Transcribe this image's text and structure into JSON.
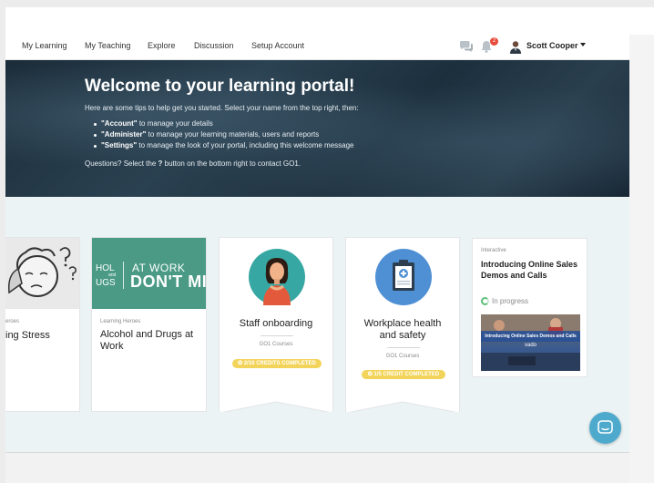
{
  "nav": {
    "items": [
      {
        "label": "My Learning"
      },
      {
        "label": "My Teaching"
      },
      {
        "label": "Explore"
      },
      {
        "label": "Discussion"
      },
      {
        "label": "Setup Account"
      }
    ],
    "notifications_count": "2",
    "user_name": "Scott Cooper"
  },
  "hero": {
    "title": "Welcome to your learning portal!",
    "intro": "Here are some tips to help get you started. Select your name from the top right, then:",
    "tips": [
      {
        "term": "\"Account\"",
        "text": " to manage your details"
      },
      {
        "term": "\"Administer\"",
        "text": " to manage your learning materials, users and reports"
      },
      {
        "term": "\"Settings\"",
        "text": " to manage the look of your portal, including this welcome message"
      }
    ],
    "question_pre": "Questions? Select the ",
    "question_mark": "?",
    "question_post": " button on the bottom right to contact GO1."
  },
  "cards": [
    {
      "provider": "eroes",
      "title": "ing Stress"
    },
    {
      "provider": "Learning Heroes",
      "title": "Alcohol and Drugs at Work",
      "image_text": {
        "left1": "HOL",
        "and": "and",
        "left2": "UGS",
        "top": "AT WORK",
        "big": "DON'T MI"
      }
    },
    {
      "title": "Staff onboarding",
      "provider": "GO1 Courses",
      "badge": "2/10 CREDITS COMPLETED"
    },
    {
      "title": "Workplace health and safety",
      "provider": "GO1 Courses",
      "badge": "1/5 CREDIT COMPLETED"
    },
    {
      "type": "Interactive",
      "title": "Introducing Online Sales Demos and Calls",
      "status": "In progress",
      "image_band": "Introducing Online Sales Demos and Calls",
      "image_logo": "vado"
    }
  ],
  "colors": {
    "accent": "#4eaacd",
    "badge": "#f3d45b",
    "progress": "#5cc07a",
    "hero_bg": "#22384a",
    "notification": "#e64b3b"
  }
}
